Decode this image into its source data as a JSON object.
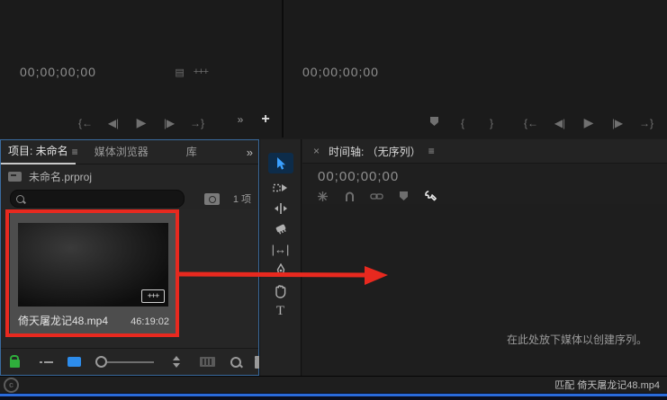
{
  "source_monitor": {
    "timecode": "00;00;00;00",
    "icons": {
      "settings_glyph": "▤",
      "export_glyph": "+++"
    },
    "transport": {
      "go_in": "{←",
      "step_back": "◀|",
      "play": "▶",
      "step_fwd": "|▶",
      "go_out": "→}"
    },
    "overflow": "»",
    "add_button": "+"
  },
  "program_monitor": {
    "timecode": "00;00;00;00",
    "mark_in": "{",
    "mark_out": "}",
    "transport": {
      "go_in": "{←",
      "step_back": "◀|",
      "play": "▶",
      "step_fwd": "|▶",
      "go_out": "→}"
    }
  },
  "project_panel": {
    "tabs": [
      {
        "label": "项目: 未命名",
        "active": true
      },
      {
        "label": "媒体浏览器",
        "active": false
      },
      {
        "label": "库",
        "active": false
      }
    ],
    "panel_menu": "≡",
    "tab_overflow": "»",
    "project_file": "未命名.prproj",
    "search_placeholder": "",
    "item_count": "1 项",
    "clip": {
      "name": "倚天屠龙记48.mp4",
      "duration": "46:19:02",
      "badge": "+++"
    }
  },
  "tools": {
    "selection": "选择工具",
    "track_select": "向前选择轨道工具",
    "ripple_edit": "波纹编辑工具",
    "razor": "剃刀工具",
    "slip_glyph": "|↔|",
    "pen": "钢笔工具",
    "hand": "手形工具",
    "type_glyph": "T"
  },
  "timeline_panel": {
    "close": "×",
    "title": "时间轴: （无序列）",
    "panel_menu": "≡",
    "timecode": "00;00;00;00",
    "drop_message": "在此处放下媒体以创建序列。"
  },
  "statusbar": {
    "text": "匹配 倚天屠龙记48.mp4",
    "cc_glyph": "c"
  },
  "colors": {
    "accent_blue": "#2d8ceb",
    "focus_border_blue": "#3a6b9e",
    "annotation_red": "#e8291f",
    "lock_green": "#2fae3c",
    "taskbar_blue": "#2a6bdb"
  }
}
